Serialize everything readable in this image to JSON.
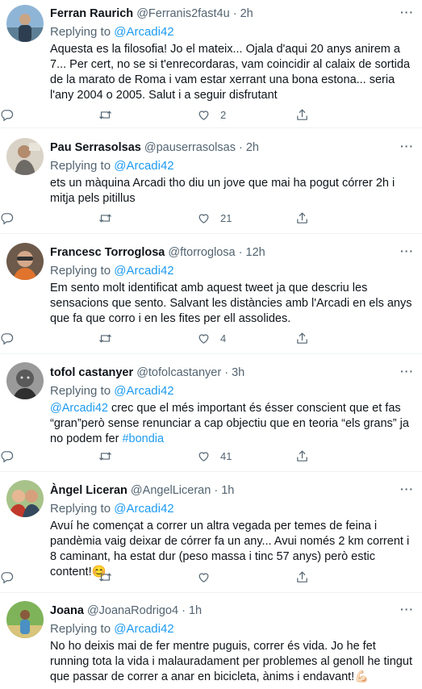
{
  "reply_prefix": "Replying to",
  "more_glyph": "···",
  "icons": [
    "reply-icon",
    "retweet-icon",
    "like-icon",
    "share-icon"
  ],
  "colors": {
    "link": "#1d9bf0",
    "secondary": "#536471",
    "border": "#eff3f4"
  },
  "tweets": [
    {
      "name": "Ferran Raurich",
      "handle": "@Ferranis2fast4u",
      "dot": "·",
      "time": "2h",
      "reply_to": "@Arcadi42",
      "text": "Aquesta es la filosofia! Jo el mateix... Ojala d'aqui 20 anys anirem a 7... Per cert, no se si t'enrecordaras, vam coincidir al calaix de sortida de la marato de Roma i vam estar xerrant una bona estona... seria l'any 2004 o 2005. Salut i a seguir disfrutant",
      "likes": "2"
    },
    {
      "name": "Pau Serrasolsas",
      "handle": "@pauserrasolsas",
      "dot": "·",
      "time": "2h",
      "reply_to": "@Arcadi42",
      "text": "ets un màquina Arcadi tho diu un jove que mai ha pogut córrer 2h i mitja pels pitillus",
      "likes": "21"
    },
    {
      "name": "Francesc Torroglosa",
      "handle": "@ftorroglosa",
      "dot": "·",
      "time": "12h",
      "reply_to": "@Arcadi42",
      "text": "Em sento molt identificat amb aquest tweet ja que descriu les sensacions que sento. Salvant les distàncies amb l'Arcadi en els anys que fa que corro i en les fites per ell assolides.",
      "likes": "4"
    },
    {
      "name": "tofol castanyer",
      "handle": "@tofolcastanyer",
      "dot": "·",
      "time": "3h",
      "reply_to": "@Arcadi42",
      "mention": "@Arcadi42",
      "text": " crec que el més important és ésser conscient que et fas “gran”però sense renunciar a cap objectiu que en teoria “els grans” ja no podem fer ",
      "hashtag": "#bondia",
      "likes": "41"
    },
    {
      "name": "Àngel Liceran",
      "handle": "@AngelLiceran",
      "dot": "·",
      "time": "1h",
      "reply_to": "@Arcadi42",
      "text": "Avuí he començat a correr un altra vegada per temes de feina i pandèmia vaig deixar de córrer fa un any... Avui només 2 km corrent i 8 caminant, ha estat dur (peso massa i tinc 57 anys) però estic content!",
      "emoji": "😊",
      "likes": ""
    },
    {
      "name": "Joana",
      "handle": "@JoanaRodrigo4",
      "dot": "·",
      "time": "1h",
      "reply_to": "@Arcadi42",
      "text": "No ho deixis mai de fer mentre puguis, correr és vida. Jo he fet running tota la vida i malauradament per problemes al genoll he tingut que passar de correr a anar en bicicleta, ànims i endavant!",
      "emoji": "💪🏻",
      "likes": ""
    }
  ]
}
